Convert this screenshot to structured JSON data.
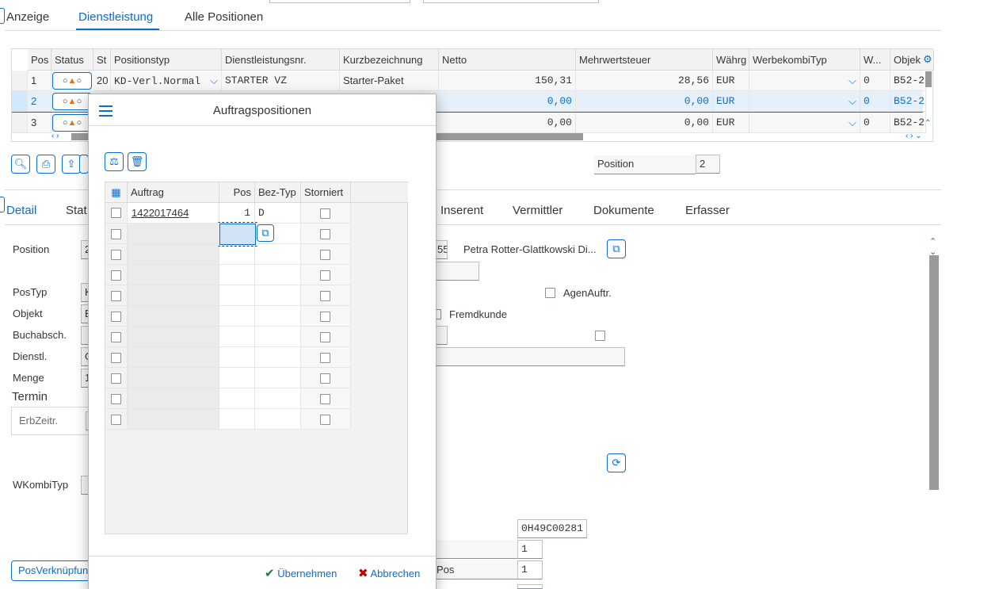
{
  "top_tabs": [
    {
      "label": "Anzeige"
    },
    {
      "label": "Dienstleistung"
    },
    {
      "label": "Alle Positionen"
    }
  ],
  "main_table": {
    "columns": [
      "Pos",
      "Status",
      "St",
      "Positionstyp",
      "Dienstleistungsnr.",
      "Kurzbezeichnung",
      "Netto",
      "Mehrwertsteuer",
      "Währg",
      "WerbekombiTyp",
      "W...",
      "Objek"
    ],
    "rows": [
      {
        "pos": "1",
        "st": "20",
        "positionstyp": "KD-Verl.Normal",
        "dienstleistungsnr": "STARTER VZ",
        "kurzbez": "Starter-Paket",
        "netto": "150,31",
        "mwst": "28,56",
        "waehrung": "EUR",
        "w": "0",
        "objekt": "B52-2"
      },
      {
        "pos": "2",
        "st": "",
        "positionstyp": "",
        "dienstleistungsnr": "",
        "kurzbez": "",
        "netto": "0,00",
        "mwst": "0,00",
        "waehrung": "EUR",
        "w": "0",
        "objekt": "B52-2"
      },
      {
        "pos": "3",
        "st": "",
        "positionstyp": "",
        "dienstleistungsnr": "",
        "kurzbez": "",
        "netto": "0,00",
        "mwst": "0,00",
        "waehrung": "EUR",
        "w": "0",
        "objekt": "B52-2"
      }
    ],
    "status_icon": "○▲○"
  },
  "position_label": "Position",
  "position_value": "2",
  "detail_tabs": [
    "Detail",
    "Stat",
    "Inserent",
    "Vermittler",
    "Dokumente",
    "Erfasser"
  ],
  "detail_fields": {
    "position": "Position",
    "position_val": "2",
    "postyp": "PosTyp",
    "postyp_val": "K",
    "objekt": "Objekt",
    "objekt_val": "B",
    "buchabsch": "Buchabsch.",
    "dienstl": "Dienstl.",
    "dienstl_val": "G",
    "menge": "Menge",
    "menge_val": "1",
    "termin": "Termin",
    "erbzeitr": "ErbZeitr.",
    "wkombityp": "WKombiTyp",
    "posverk": "PosVerknüpfun",
    "partner_num": "55",
    "partner_name": "Petra Rotter-Glattkowski Di...",
    "agenauftr": "AgenAuftr.",
    "fremdkunde": "Fremdkunde",
    "code_val": "0H49C00281",
    "val1": "1",
    "pos_label": "Pos",
    "val2": "1"
  },
  "dialog": {
    "title": "Auftragspositionen",
    "columns": [
      "Auftrag",
      "Pos",
      "Bez-Typ",
      "Storniert"
    ],
    "rows": [
      {
        "auftrag": "1422017464",
        "pos": "1",
        "beztyp": "D"
      }
    ],
    "empty_rows": 10,
    "confirm_label": "Übernehmen",
    "cancel_label": "Abbrechen"
  }
}
